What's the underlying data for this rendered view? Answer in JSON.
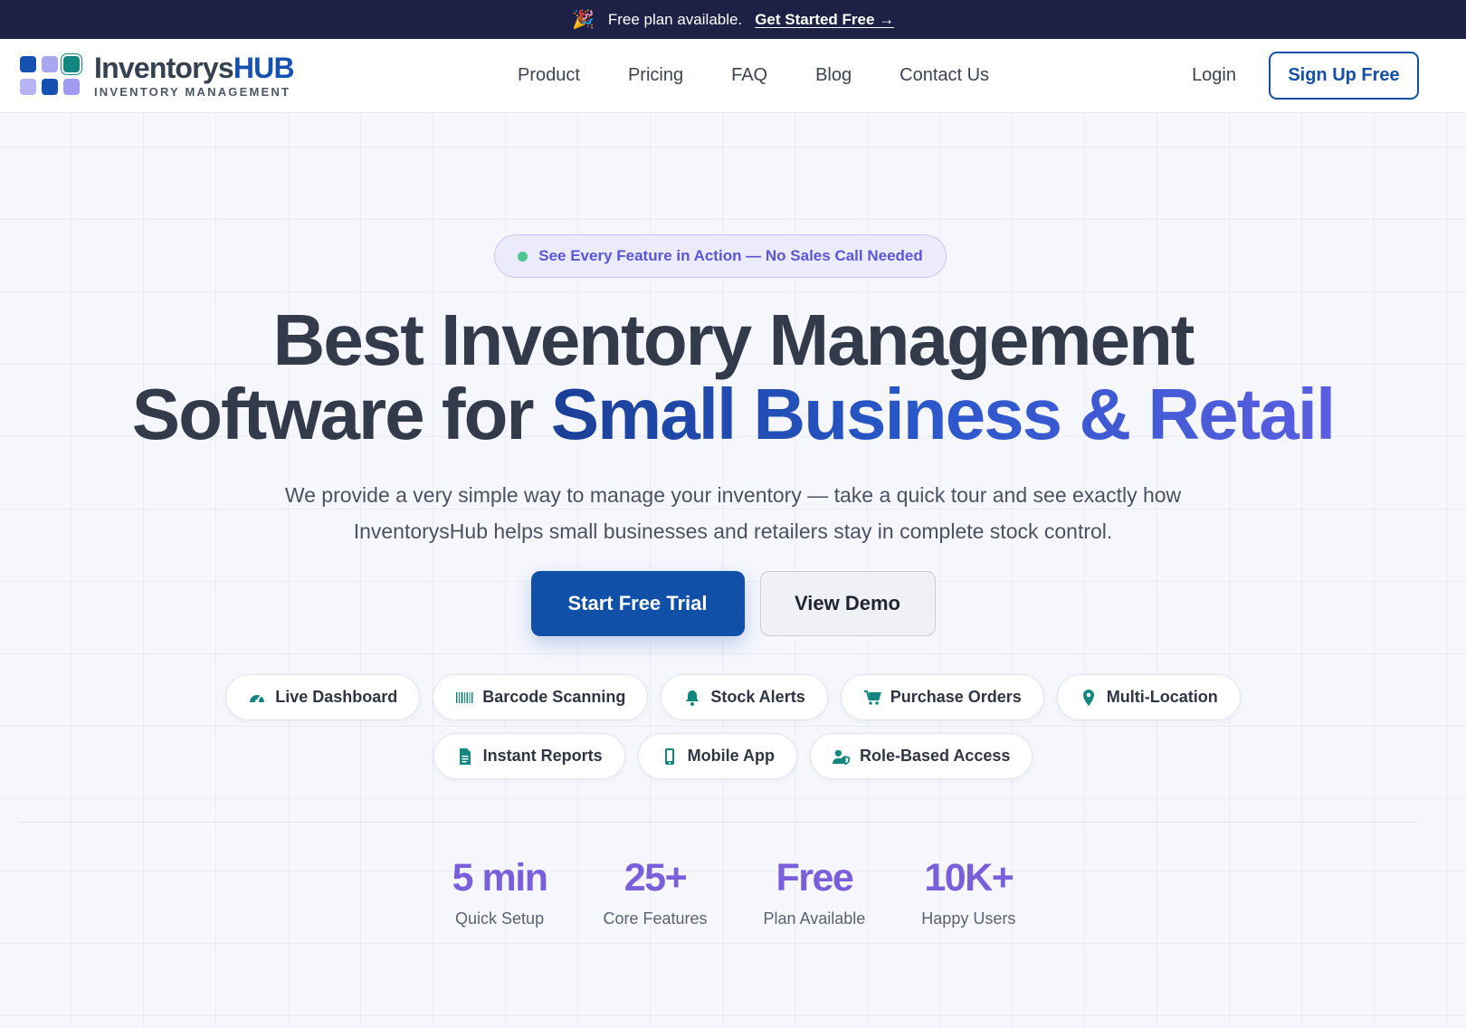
{
  "announcement": {
    "icon": "party-popper-icon",
    "text": "Free plan available.",
    "link": "Get Started Free →"
  },
  "brand": {
    "name_main": "Inventorys",
    "name_accent": "HUB",
    "tagline": "INVENTORY MANAGEMENT",
    "logo_colors": [
      "#1552b0",
      "#a9a6f0",
      "#13877f",
      "#b7b4f3",
      "#1552b0",
      "#9f9bf0"
    ]
  },
  "nav": {
    "items": [
      "Product",
      "Pricing",
      "FAQ",
      "Blog",
      "Contact Us"
    ],
    "login": "Login",
    "signup": "Sign Up Free"
  },
  "hero": {
    "pill": "See Every Feature in Action — No Sales Call Needed",
    "headline_line1": "Best Inventory Management",
    "headline_line2_plain": "Software for ",
    "headline_line2_accent": "Small Business & Retail",
    "subtitle": "We provide a very simple way to manage your inventory — take a quick tour and see exactly how InventorysHub helps small businesses and retailers stay in complete stock control.",
    "cta_primary": "Start Free Trial",
    "cta_secondary": "View Demo"
  },
  "features": {
    "row1": [
      {
        "label": "Live Dashboard",
        "icon": "gauge-icon"
      },
      {
        "label": "Barcode Scanning",
        "icon": "barcode-icon"
      },
      {
        "label": "Stock Alerts",
        "icon": "bell-icon"
      },
      {
        "label": "Purchase Orders",
        "icon": "cart-icon"
      },
      {
        "label": "Multi-Location",
        "icon": "map-pin-icon"
      }
    ],
    "row2": [
      {
        "label": "Instant Reports",
        "icon": "document-icon"
      },
      {
        "label": "Mobile App",
        "icon": "phone-icon"
      },
      {
        "label": "Role-Based Access",
        "icon": "user-shield-icon"
      }
    ],
    "icon_color": "#13877f"
  },
  "stats": [
    {
      "value": "5 min",
      "label": "Quick Setup"
    },
    {
      "value": "25+",
      "label": "Core Features"
    },
    {
      "value": "Free",
      "label": "Plan Available"
    },
    {
      "value": "10K+",
      "label": "Happy Users"
    }
  ],
  "colors": {
    "topbar": "#1c2145",
    "primary": "#1050a8",
    "accent_purple": "#7a5fdb",
    "teal": "#13877f"
  }
}
